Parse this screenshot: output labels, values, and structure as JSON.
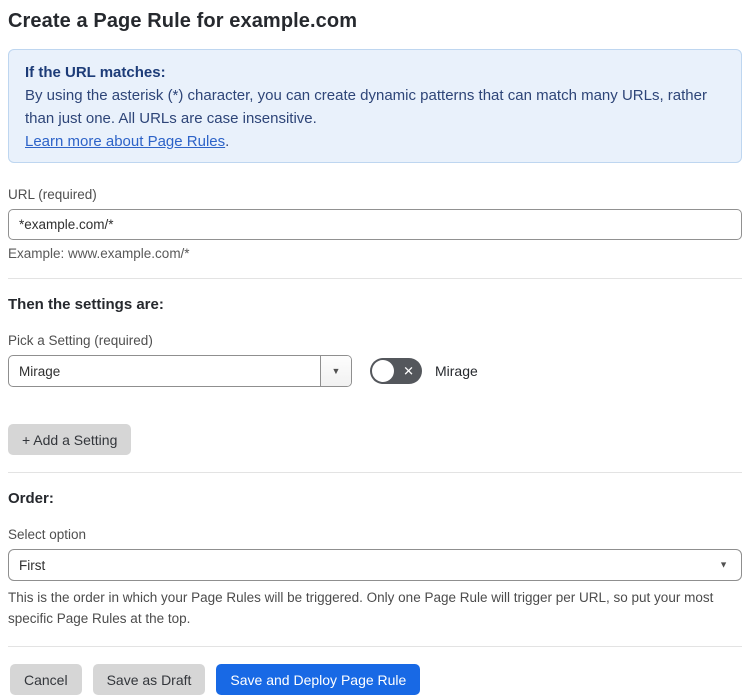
{
  "page": {
    "title": "Create a Page Rule for example.com"
  },
  "info_box": {
    "heading": "If the URL matches:",
    "body": "By using the asterisk (*) character, you can create dynamic patterns that can match many URLs, rather than just one. All URLs are case insensitive.",
    "link_text": "Learn more about Page Rules",
    "link_suffix": "."
  },
  "url_field": {
    "label": "URL (required)",
    "value": "*example.com/*",
    "helper": "Example: www.example.com/*"
  },
  "settings_section": {
    "heading": "Then the settings are:",
    "picker_label": "Pick a Setting (required)",
    "picker_value": "Mirage",
    "toggle": {
      "state": "off",
      "label": "Mirage"
    },
    "add_button_label": "+ Add a Setting"
  },
  "order_section": {
    "heading": "Order:",
    "select_label": "Select option",
    "select_value": "First",
    "helper": "This is the order in which your Page Rules will be triggered. Only one Page Rule will trigger per URL, so put your most specific Page Rules at the top."
  },
  "footer": {
    "cancel_label": "Cancel",
    "save_draft_label": "Save as Draft",
    "save_deploy_label": "Save and Deploy Page Rule"
  },
  "icons": {
    "dropdown_arrow": "▼",
    "toggle_x": "✕"
  },
  "colors": {
    "primary_button": "#1869e5",
    "info_background": "#e9f1fb",
    "info_border": "#bed6f0",
    "info_heading_text": "#1d3c78",
    "info_body_text": "#2e4578",
    "link": "#2d63c8",
    "gray_button": "#d6d6d6",
    "toggle_off": "#54575c",
    "input_border": "#919191"
  }
}
